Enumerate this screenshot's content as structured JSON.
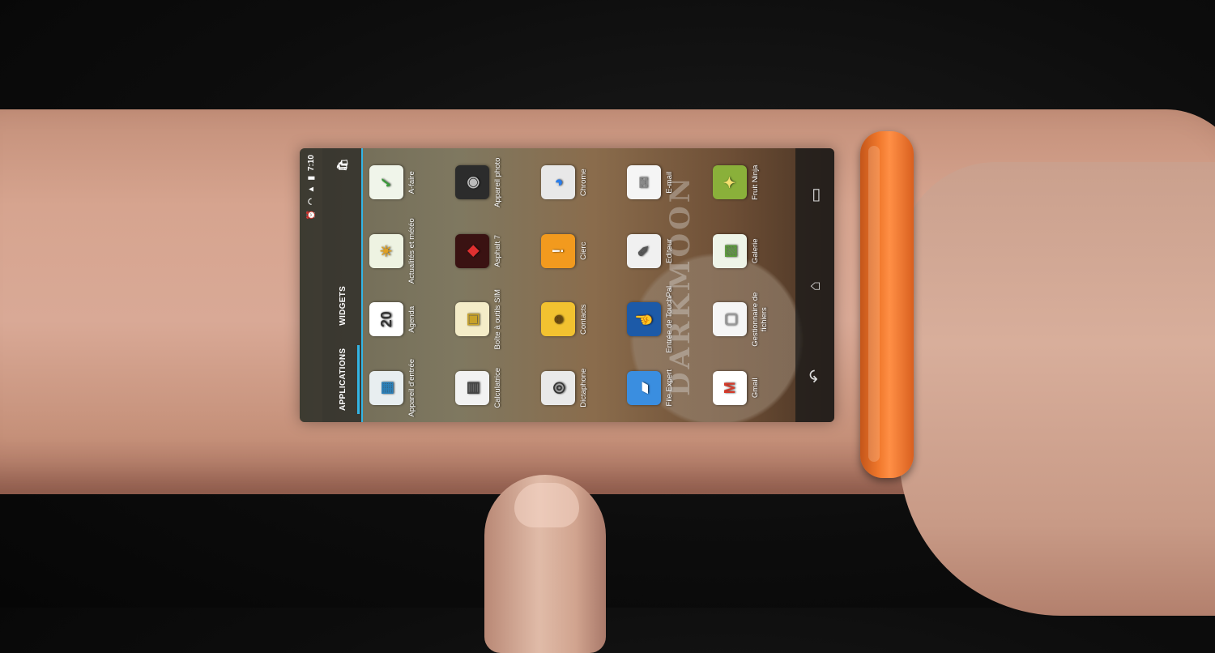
{
  "status_bar": {
    "time": "7:10",
    "icons": [
      "battery-icon",
      "signal-icon",
      "wifi-icon",
      "alarm-icon"
    ]
  },
  "tabs": [
    {
      "label": "APPLICATIONS",
      "active": true
    },
    {
      "label": "WIDGETS",
      "active": false
    }
  ],
  "store_icon": "play-store-icon",
  "apps": [
    {
      "label": "Appareil d'entrée",
      "icon": "appareil-entree-icon",
      "glyph": "▦",
      "bg": "#e8eef0",
      "fg": "#2a7fb8"
    },
    {
      "label": "Agenda",
      "icon": "calendar-icon",
      "glyph": "20",
      "bg": "#ffffff",
      "fg": "#333333"
    },
    {
      "label": "Actualités et météo",
      "icon": "news-weather-icon",
      "glyph": "☀",
      "bg": "#eef3e2",
      "fg": "#e0a020"
    },
    {
      "label": "A-faire",
      "icon": "todo-icon",
      "glyph": "✓",
      "bg": "#f0f5ea",
      "fg": "#3a9a3a"
    },
    {
      "label": "Calculatrice",
      "icon": "calculator-icon",
      "glyph": "▤",
      "bg": "#f2f2f2",
      "fg": "#444444"
    },
    {
      "label": "Boîte à outils SIM",
      "icon": "sim-toolkit-icon",
      "glyph": "▣",
      "bg": "#f4ecc8",
      "fg": "#c8a22a"
    },
    {
      "label": "Asphalt 7",
      "icon": "asphalt-icon",
      "glyph": "◆",
      "bg": "#3a1212",
      "fg": "#e03030"
    },
    {
      "label": "Appareil photo",
      "icon": "camera-icon",
      "glyph": "◉",
      "bg": "#2c2c2c",
      "fg": "#bbbbbb"
    },
    {
      "label": "Dictaphone",
      "icon": "voice-recorder-icon",
      "glyph": "◎",
      "bg": "#e9e9e9",
      "fg": "#333333"
    },
    {
      "label": "Contacts",
      "icon": "contacts-icon",
      "glyph": "☻",
      "bg": "#f2c230",
      "fg": "#6b4a10"
    },
    {
      "label": "Cierc",
      "icon": "cierc-icon",
      "glyph": "!",
      "bg": "#f29a1e",
      "fg": "#ffffff"
    },
    {
      "label": "Chrome",
      "icon": "chrome-icon",
      "glyph": "◕",
      "bg": "#e8e8e8",
      "fg": "#2b7de9"
    },
    {
      "label": "File Expert",
      "icon": "file-expert-icon",
      "glyph": "▰",
      "bg": "#3a8ee0",
      "fg": "#ffffff"
    },
    {
      "label": "Entrée de TouchPal",
      "icon": "touchpal-icon",
      "glyph": "☝",
      "bg": "#1c5aa8",
      "fg": "#ffffff"
    },
    {
      "label": "Editeur",
      "icon": "editor-icon",
      "glyph": "✎",
      "bg": "#f0f0f0",
      "fg": "#555555"
    },
    {
      "label": "E-mail",
      "icon": "email-icon",
      "glyph": "✉",
      "bg": "#f5f5f5",
      "fg": "#888888"
    },
    {
      "label": "Gmail",
      "icon": "gmail-icon",
      "glyph": "M",
      "bg": "#ffffff",
      "fg": "#d63a2a"
    },
    {
      "label": "Gestionnaire de fichiers",
      "icon": "file-manager-icon",
      "glyph": "▢",
      "bg": "#f5f5f5",
      "fg": "#999999"
    },
    {
      "label": "Galerie",
      "icon": "gallery-icon",
      "glyph": "▨",
      "bg": "#eef4e8",
      "fg": "#5a9a3a"
    },
    {
      "label": "Fruit Ninja",
      "icon": "fruit-ninja-icon",
      "glyph": "✦",
      "bg": "#8ab03a",
      "fg": "#f5e070"
    }
  ],
  "watermark": "DARKMOON",
  "nav": [
    {
      "name": "back-icon",
      "glyph": "↶"
    },
    {
      "name": "home-icon",
      "glyph": "⌂"
    },
    {
      "name": "recent-apps-icon",
      "glyph": "▭"
    }
  ]
}
